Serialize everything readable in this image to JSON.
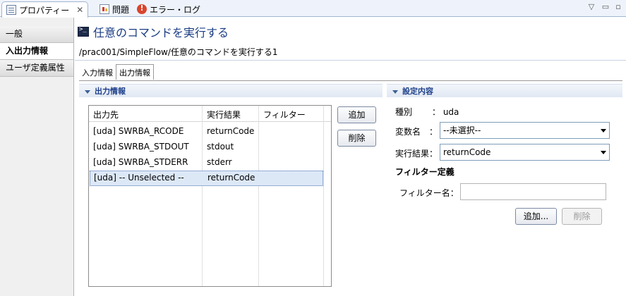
{
  "tabs": [
    {
      "label": "プロパティー",
      "active": true
    },
    {
      "label": "問題",
      "active": false
    },
    {
      "label": "エラー・ログ",
      "active": false
    }
  ],
  "window_controls": {
    "menu": "▽",
    "minimize": "▭",
    "maximize": "▫"
  },
  "sidebar": {
    "items": [
      {
        "label": "一般",
        "selected": false
      },
      {
        "label": "入出力情報",
        "selected": true
      },
      {
        "label": "ユーザ定義属性",
        "selected": false
      }
    ]
  },
  "header": {
    "title": "任意のコマンドを実行する",
    "path": "/prac001/SimpleFlow/任意のコマンドを実行する1"
  },
  "subtabs": [
    {
      "label": "入力情報",
      "active": false
    },
    {
      "label": "出力情報",
      "active": true
    }
  ],
  "output_section": {
    "title": "出力情報",
    "columns": [
      "出力先",
      "実行結果",
      "フィルター"
    ],
    "rows": [
      {
        "dest": "[uda] SWRBA_RCODE",
        "result": "returnCode",
        "filter": "",
        "selected": false
      },
      {
        "dest": "[uda] SWRBA_STDOUT",
        "result": "stdout",
        "filter": "",
        "selected": false
      },
      {
        "dest": "[uda] SWRBA_STDERR",
        "result": "stderr",
        "filter": "",
        "selected": false
      },
      {
        "dest": "[uda] -- Unselected --",
        "result": "returnCode",
        "filter": "",
        "selected": true
      }
    ],
    "add_label": "追加",
    "delete_label": "削除"
  },
  "settings_section": {
    "title": "設定内容",
    "kind_label": "種別",
    "kind_value": "： uda",
    "variable_label": "変数名　：",
    "variable_value": "--未選択--",
    "result_label": "実行結果：",
    "result_value": "returnCode",
    "filter_def_title": "フィルター定義",
    "filter_name_label": "フィルター名：",
    "filter_name_value": "",
    "add_label": "追加...",
    "delete_label": "削除"
  }
}
